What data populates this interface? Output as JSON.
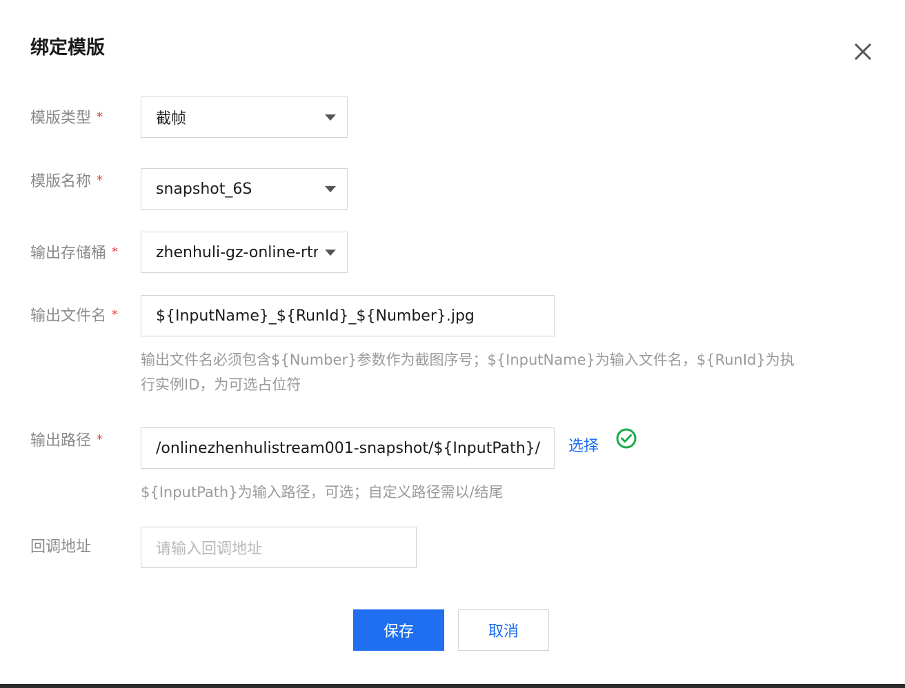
{
  "dialog": {
    "title": "绑定模版",
    "close_icon": "close-icon"
  },
  "form": {
    "required_mark": "*",
    "template_type": {
      "label": "模版类型",
      "value": "截帧"
    },
    "template_name": {
      "label": "模版名称",
      "value": "snapshot_6S"
    },
    "output_bucket": {
      "label": "输出存储桶",
      "value": "zhenhuli-gz-online-rtm"
    },
    "output_filename": {
      "label": "输出文件名",
      "value": "${InputName}_${RunId}_${Number}.jpg",
      "help_line1": "输出文件名必须包含${Number}参数作为截图序号；${InputName}为输入文件名，${RunId}为执",
      "help_line2": "行实例ID，为可选占位符"
    },
    "output_path": {
      "label": "输出路径",
      "value": "/onlinezhenhulistream001-snapshot/${InputPath}/",
      "select_label": "选择",
      "status_icon": "check-circle-icon",
      "help": "${InputPath}为输入路径，可选；自定义路径需以/结尾"
    },
    "callback": {
      "label": "回调地址",
      "placeholder": "请输入回调地址"
    }
  },
  "footer": {
    "save_label": "保存",
    "cancel_label": "取消"
  },
  "colors": {
    "primary": "#1f6ff0",
    "link": "#1d6ff2",
    "required": "#e54545",
    "success": "#1aaa4a"
  }
}
